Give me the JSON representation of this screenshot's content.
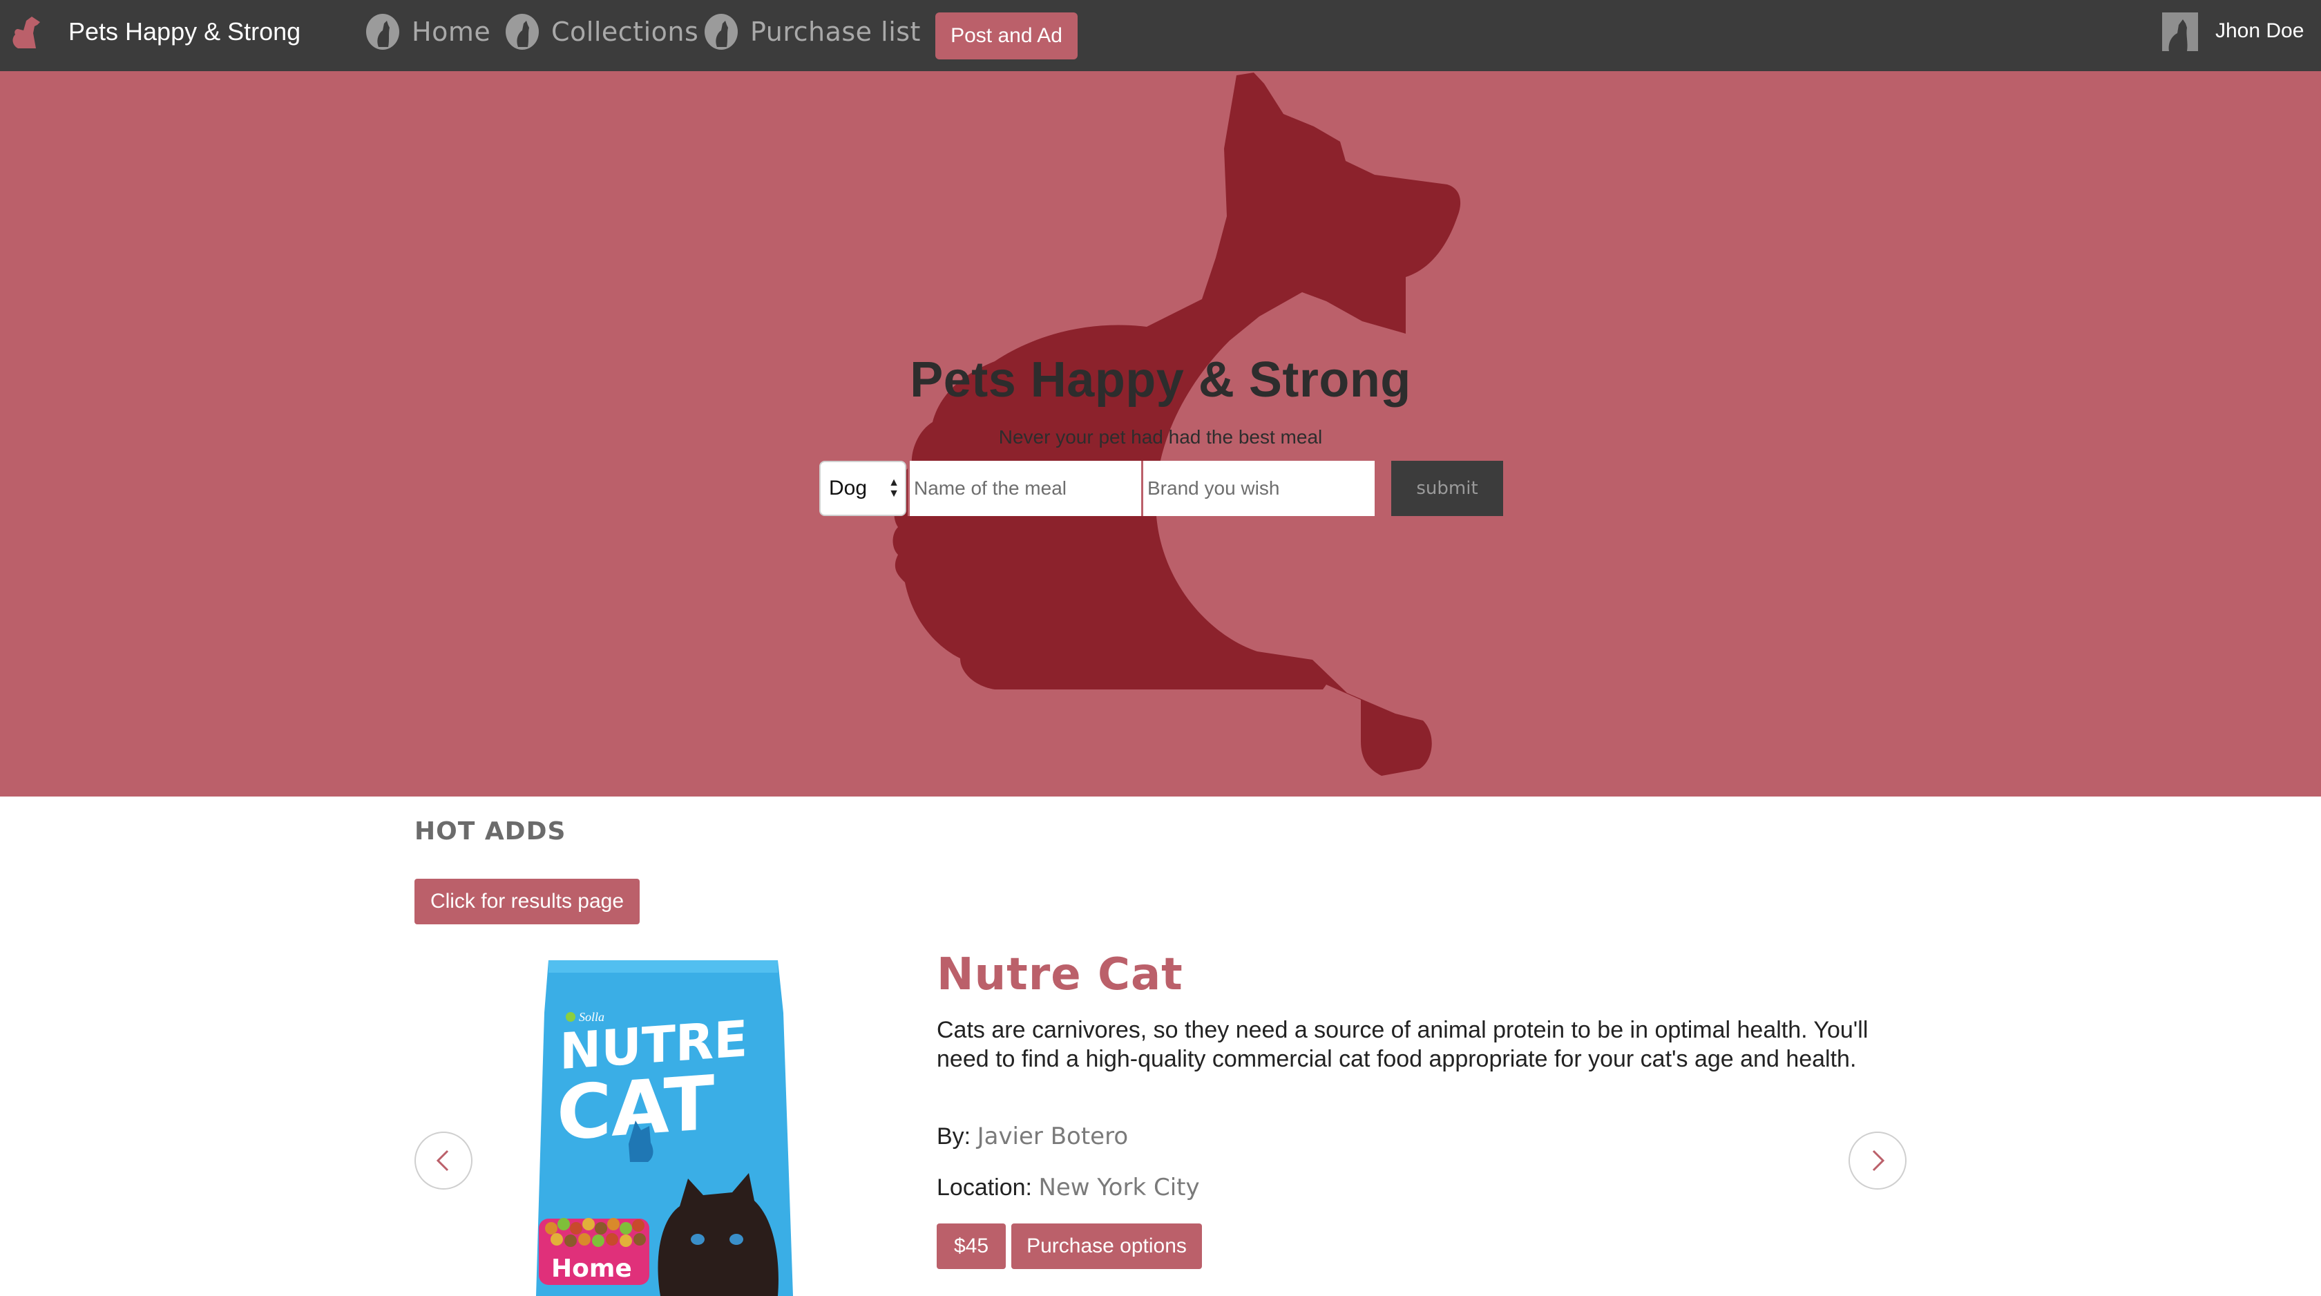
{
  "navbar": {
    "brand": "Pets Happy & Strong",
    "links": [
      {
        "label": "Home",
        "icon": "cat-icon"
      },
      {
        "label": "Collections",
        "icon": "cat-icon"
      },
      {
        "label": "Purchase list",
        "icon": "cat-icon"
      }
    ],
    "post_button": "Post and Ad",
    "user_name": "Jhon Doe"
  },
  "hero": {
    "title": "Pets Happy & Strong",
    "subtitle": "Never your pet had had the best meal",
    "pet_select_value": "Dog",
    "meal_placeholder": "Name of the meal",
    "brand_placeholder": "Brand you wish",
    "submit_label": "submit"
  },
  "hot_adds": {
    "title": "HOT ADDS",
    "results_button": "Click for results page",
    "product": {
      "name": "Nutre Cat",
      "description": "Cats are carnivores, so they need a source of animal protein to be in optimal health. You'll need to find a high-quality commercial cat food appropriate for your cat's age and health.",
      "by_label": "By:",
      "by_value": "Javier Botero",
      "location_label": "Location:",
      "location_value": "New York City",
      "price": "$45",
      "purchase_button": "Purchase options",
      "bag_brand": "Solla",
      "bag_line1": "NUTRE",
      "bag_line2": "CAT",
      "bag_variant": "Home"
    }
  },
  "colors": {
    "accent": "#bb606a",
    "dog_silhouette": "#8c222c",
    "navbar_bg": "#3c3c3c",
    "bag_blue": "#3aaee6",
    "bag_pink": "#e0307a"
  }
}
